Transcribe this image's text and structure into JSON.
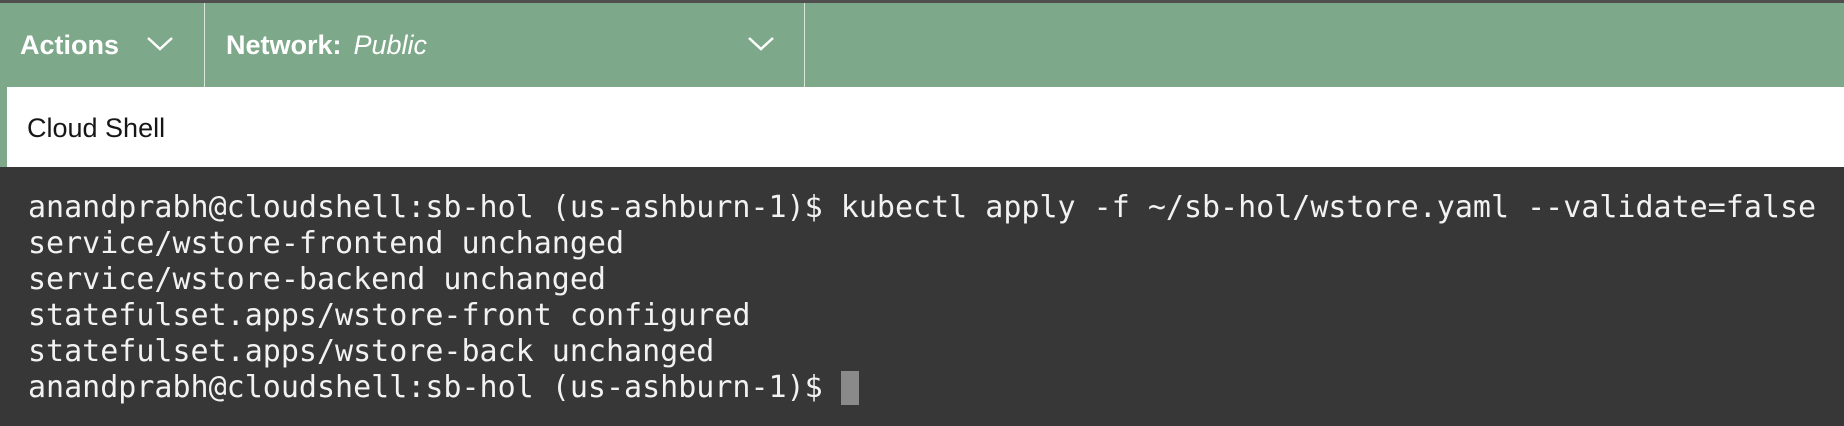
{
  "toolbar": {
    "actions_label": "Actions",
    "network_label": "Network:",
    "network_value": "Public"
  },
  "panel": {
    "title": "Cloud Shell"
  },
  "terminal": {
    "lines": [
      "anandprabh@cloudshell:sb-hol (us-ashburn-1)$ kubectl apply -f ~/sb-hol/wstore.yaml --validate=false",
      "service/wstore-frontend unchanged",
      "service/wstore-backend unchanged",
      "statefulset.apps/wstore-front configured",
      "statefulset.apps/wstore-back unchanged"
    ],
    "prompt": "anandprabh@cloudshell:sb-hol (us-ashburn-1)$"
  },
  "icons": {
    "actions_dropdown": "chevron-down-icon",
    "network_dropdown": "chevron-down-icon"
  },
  "colors": {
    "toolbar_bg": "#7da88a",
    "terminal_bg": "#373737",
    "terminal_text": "#f2f2f2",
    "cursor": "#8a8a8a"
  }
}
